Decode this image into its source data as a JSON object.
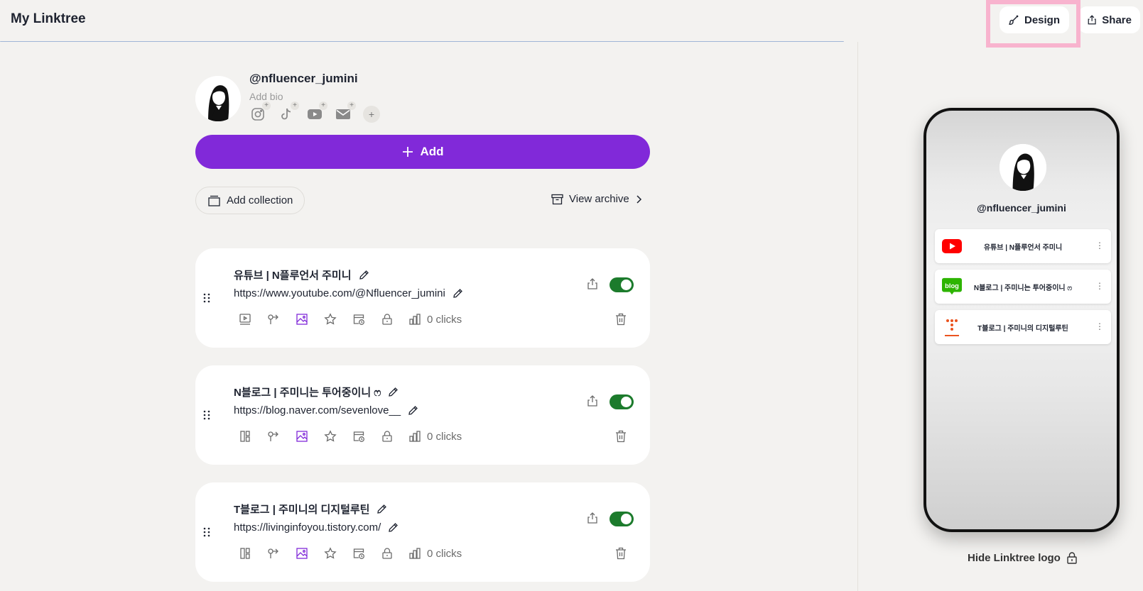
{
  "header": {
    "title": "My Linktree",
    "design_label": "Design",
    "share_label": "Share"
  },
  "profile": {
    "username": "@nfluencer_jumini",
    "bio_placeholder": "Add bio",
    "social_icons": [
      "instagram-icon",
      "tiktok-icon",
      "youtube-icon",
      "email-icon"
    ],
    "add_social_label": "+"
  },
  "actions": {
    "add_label": "Add",
    "add_collection_label": "Add collection",
    "view_archive_label": "View archive"
  },
  "links": [
    {
      "title": "유튜브 | N플루언서 주미니",
      "url": "https://www.youtube.com/@Nfluencer_jumini",
      "clicks": "0 clicks",
      "enabled": true
    },
    {
      "title": "N블로그 | 주미니는 투어중이니 ෆ",
      "url": "https://blog.naver.com/sevenlove__",
      "clicks": "0 clicks",
      "enabled": true
    },
    {
      "title": "T블로그 | 주미니의 디지털루틴",
      "url": "https://livinginfoyou.tistory.com/",
      "clicks": "0 clicks",
      "enabled": true
    }
  ],
  "preview": {
    "username": "@nfluencer_jumini",
    "links": [
      {
        "label": "유튜브 | N플루언서 주미니",
        "icon": "youtube-icon"
      },
      {
        "label": "N블로그 | 주미니는 투어중이니 ෆ",
        "icon": "naver-blog-icon",
        "icon_text": "blog"
      },
      {
        "label": "T블로그 | 주미니의 디지털루틴",
        "icon": "tistory-icon"
      }
    ],
    "more_label": "⋮",
    "hide_logo_label": "Hide Linktree logo"
  },
  "colors": {
    "accent": "#8129d9",
    "toggle_on": "#1c7b2c",
    "background": "#f3f2f0",
    "highlight": "#f8b3ce"
  }
}
